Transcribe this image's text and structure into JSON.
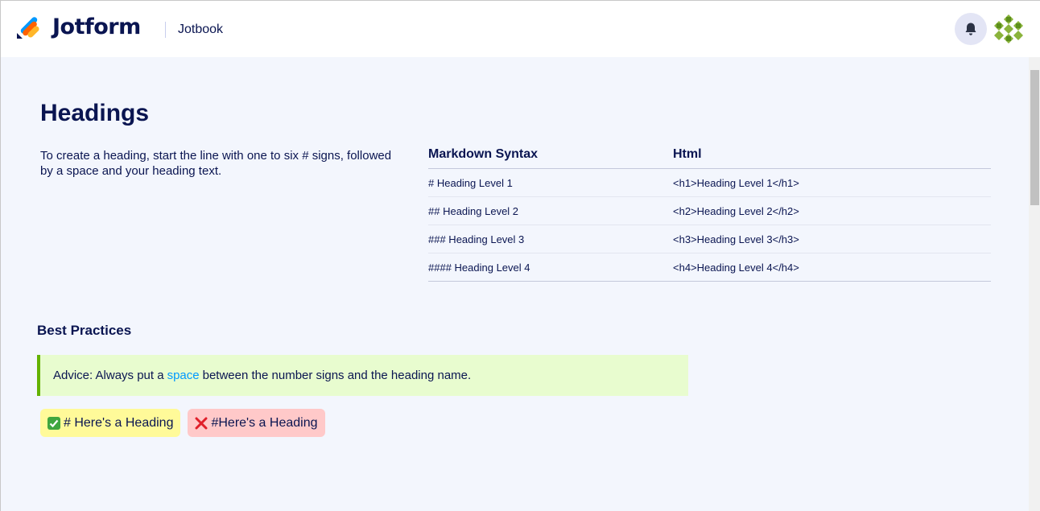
{
  "header": {
    "brand": "Jotform",
    "product": "Jotbook"
  },
  "page": {
    "title": "Headings",
    "intro": "To create a heading, start the line with one to six # signs, followed by a space and your heading text."
  },
  "table": {
    "columns": [
      "Markdown Syntax",
      "Html"
    ],
    "rows": [
      [
        "# Heading Level 1",
        "<h1>Heading Level 1</h1>"
      ],
      [
        "## Heading Level 2",
        "<h2>Heading Level 2</h2>"
      ],
      [
        "### Heading Level 3",
        "<h3>Heading Level 3</h3>"
      ],
      [
        "#### Heading Level 4",
        "<h4>Heading Level 4</h4>"
      ]
    ]
  },
  "best_practices": {
    "title": "Best Practices",
    "advice_before": "Advice: Always put a",
    "advice_link": "space",
    "advice_after": "between the number signs and the heading name.",
    "good_example": "# Here's a Heading",
    "bad_example": "#Here's a Heading",
    "good_icon": "check-mark-icon",
    "bad_icon": "cross-mark-icon"
  },
  "colors": {
    "brand_navy": "#0a1551",
    "advice_bg": "#e8fccf",
    "advice_border": "#64b200",
    "link": "#0099ff",
    "good_bg": "#fffa99",
    "bad_bg": "#ffc9c9"
  }
}
